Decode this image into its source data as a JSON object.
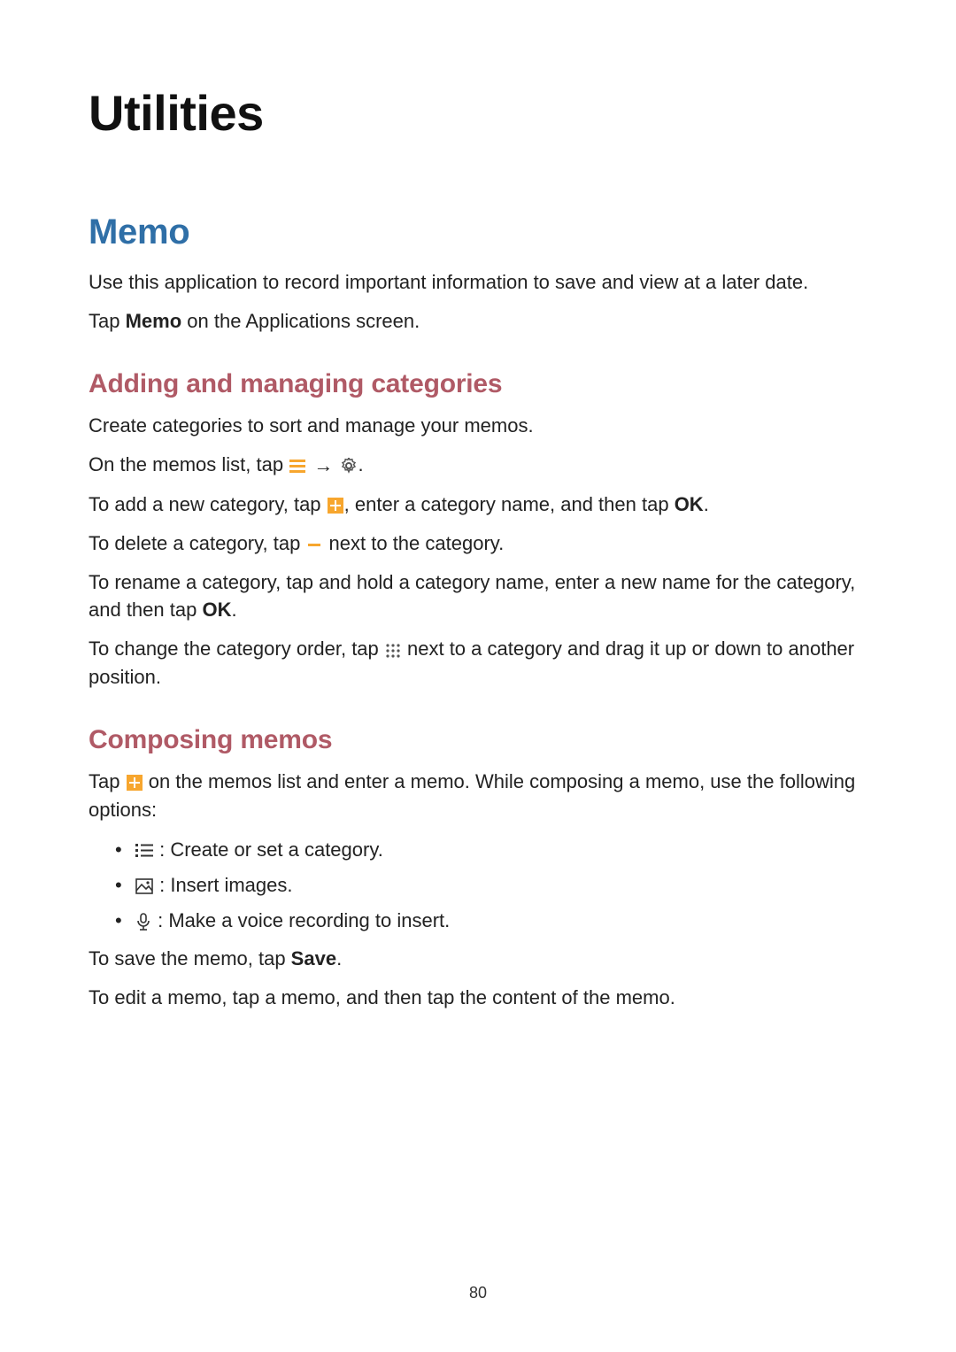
{
  "page": {
    "number": "80",
    "chapter_title": "Utilities",
    "section_title": "Memo",
    "intro_p1": "Use this application to record important information to save and view at a later date.",
    "intro_p2_pre": "Tap ",
    "intro_p2_bold": "Memo",
    "intro_p2_post": " on the Applications screen.",
    "sub1_title": "Adding and managing categories",
    "sub1_p1": "Create categories to sort and manage your memos.",
    "sub1_p2_pre": "On the memos list, tap ",
    "sub1_p2_arrow": "→",
    "sub1_p2_post": ".",
    "sub1_p3_pre": "To add a new category, tap ",
    "sub1_p3_mid": ", enter a category name, and then tap ",
    "sub1_p3_bold": "OK",
    "sub1_p3_post": ".",
    "sub1_p4_pre": "To delete a category, tap ",
    "sub1_p4_post": " next to the category.",
    "sub1_p5_pre": "To rename a category, tap and hold a category name, enter a new name for the category, and then tap ",
    "sub1_p5_bold": "OK",
    "sub1_p5_post": ".",
    "sub1_p6_pre": "To change the category order, tap ",
    "sub1_p6_post": " next to a category and drag it up or down to another position.",
    "sub2_title": "Composing memos",
    "sub2_p1_pre": "Tap ",
    "sub2_p1_post": " on the memos list and enter a memo. While composing a memo, use the following options:",
    "sub2_b1": " : Create or set a category.",
    "sub2_b2": " : Insert images.",
    "sub2_b3": " : Make a voice recording to insert.",
    "sub2_p2_pre": "To save the memo, tap ",
    "sub2_p2_bold": "Save",
    "sub2_p2_post": ".",
    "sub2_p3": "To edit a memo, tap a memo, and then tap the content of the memo."
  }
}
